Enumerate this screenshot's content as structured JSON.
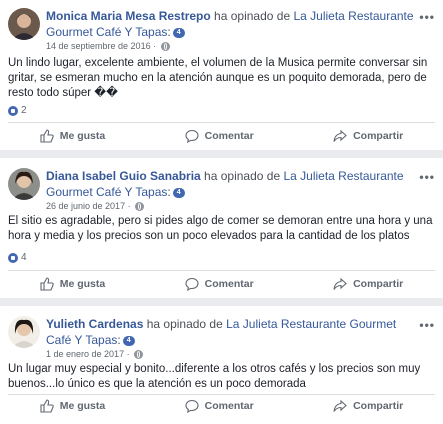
{
  "reviews": [
    {
      "name": "Monica Maria Mesa Restrepo",
      "verb": " ha opinado de ",
      "page": "La Julieta Restaurante Gourmet Café Y Tapas",
      "badge_count": "4",
      "date": "14 de septiembre de 2016",
      "text": "Un lindo lugar, excelente ambiente, el volumen de la Musica permite conversar sin gritar, se esmeran mucho en la atención aunque es un poquito demorada, pero de resto todo súper ��",
      "reaction_count": "2"
    },
    {
      "name": "Diana Isabel Guio Sanabria",
      "verb": " ha opinado de ",
      "page": "La Julieta Restaurante Gourmet Café Y Tapas",
      "badge_count": "4",
      "date": "26 de junio de 2017",
      "text": "El sitio es agradable, pero si pides algo de comer se demoran entre una hora y una hora y media y los precios son un poco elevados para la cantidad de los platos",
      "reaction_count": "4"
    },
    {
      "name": "Yulieth Cardenas",
      "verb": " ha opinado de ",
      "page": "La Julieta Restaurante Gourmet Café Y Tapas",
      "badge_count": "4",
      "date": "1 de enero de 2017",
      "text": "Un lugar muy especial y bonito...diferente a los otros cafés y los precios son muy buenos...lo único es que la atención es un poco demorada",
      "reaction_count": ""
    }
  ],
  "actions": {
    "like": "Me gusta",
    "comment": "Comentar",
    "share": "Compartir"
  },
  "more_label": "•••"
}
